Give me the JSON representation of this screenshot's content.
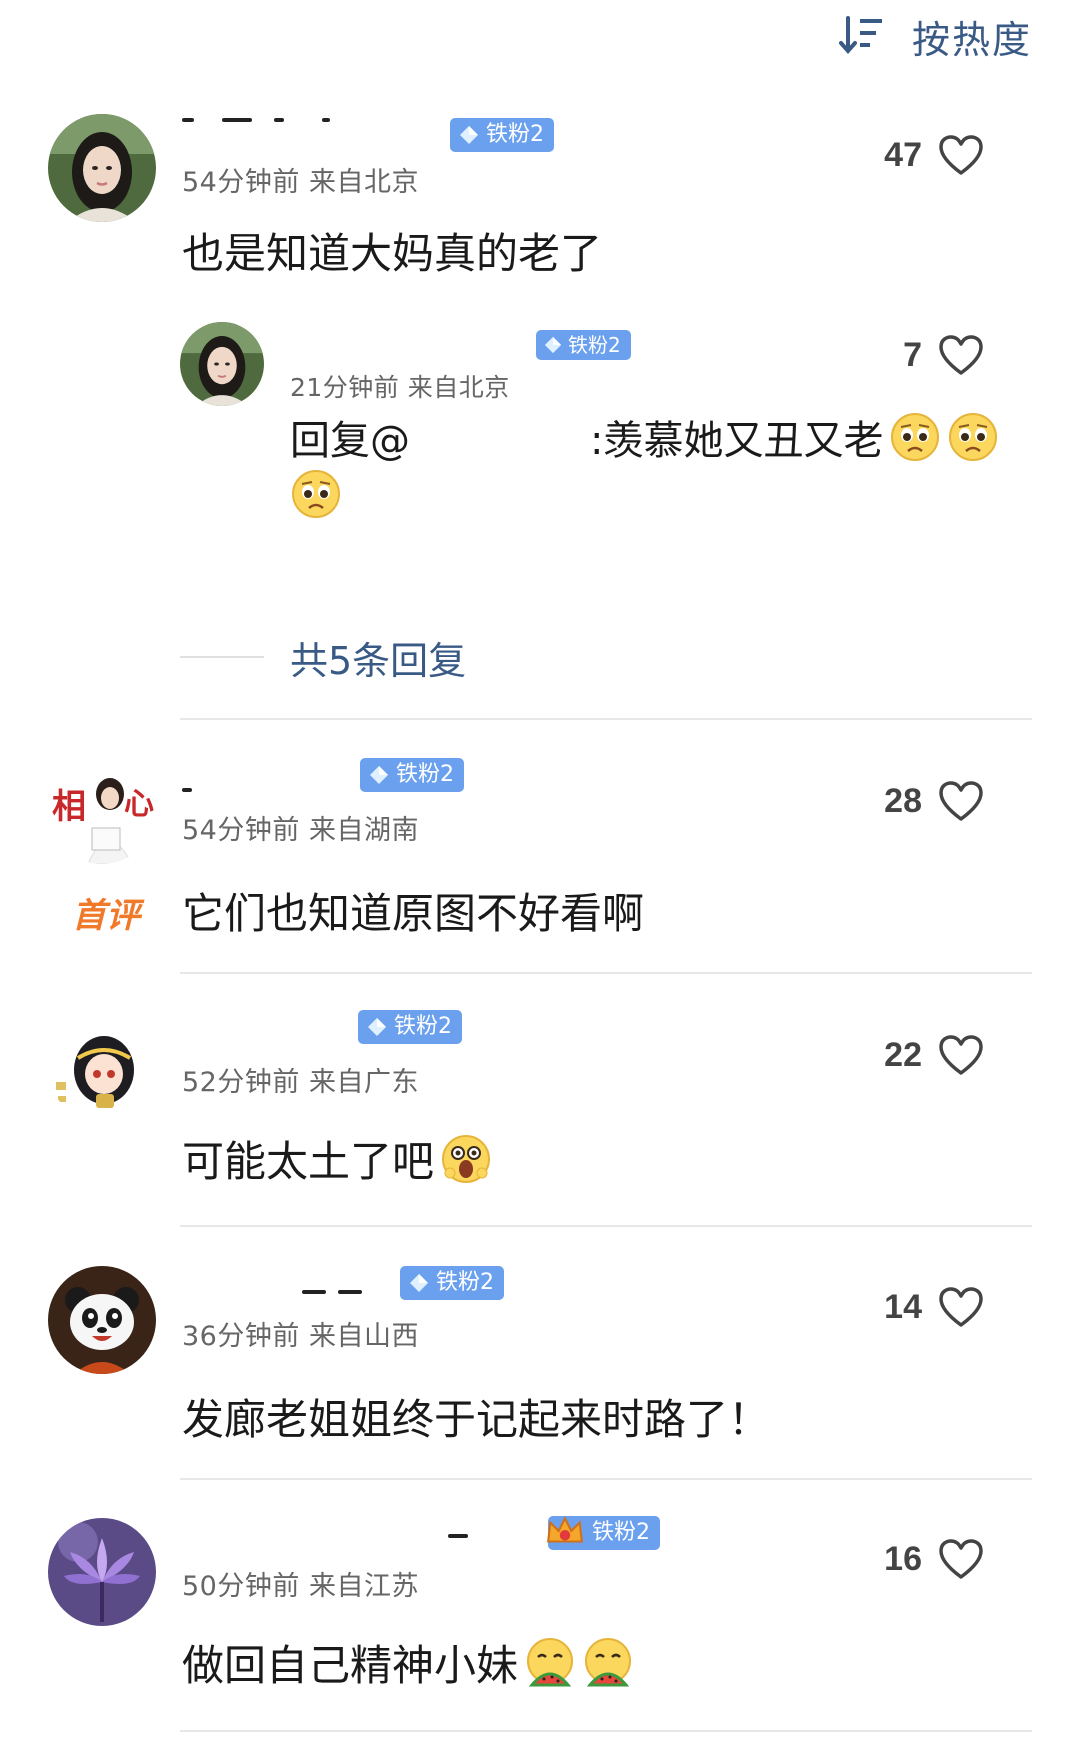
{
  "sort": {
    "label": "按热度",
    "icon": "sort-descending-icon"
  },
  "more_replies_label": "共5条回复",
  "first_comment_tag": "首评",
  "comments": [
    {
      "meta": "54分钟前 来自北京",
      "badge": "铁粉2",
      "likes": "47",
      "text": "也是知道大妈真的老了",
      "avatar": "woman-portrait-avatar",
      "reply": {
        "meta": "21分钟前 来自北京",
        "badge": "铁粉2",
        "likes": "7",
        "text_prefix": "回复@",
        "text_mention": "：",
        "text": ":羡慕她又丑又老",
        "emoji": "pleading-face-emoji"
      }
    },
    {
      "meta": "54分钟前 来自湖南",
      "badge": "铁粉2",
      "likes": "28",
      "text": "它们也知道原图不好看啊",
      "avatar": "girl-with-calligraphy-avatar"
    },
    {
      "meta": "52分钟前 来自广东",
      "badge": "铁粉2",
      "likes": "22",
      "text": "可能太土了吧",
      "avatar": "anime-girl-avatar",
      "emoji": "shocked-face-emoji"
    },
    {
      "meta": "36分钟前 来自山西",
      "badge": "铁粉2",
      "likes": "14",
      "text": "发廊老姐姐终于记起来时路了！",
      "avatar": "panda-avatar"
    },
    {
      "meta": "50分钟前 来自江苏",
      "badge": "铁粉2",
      "likes": "16",
      "text": "做回自己精神小妹",
      "avatar": "purple-lotus-avatar",
      "emoji": "eating-watermelon-emoji"
    }
  ],
  "colors": {
    "link": "#3a5a86",
    "badge": "#6aa0ee",
    "first_tag": "#f07a2a"
  }
}
